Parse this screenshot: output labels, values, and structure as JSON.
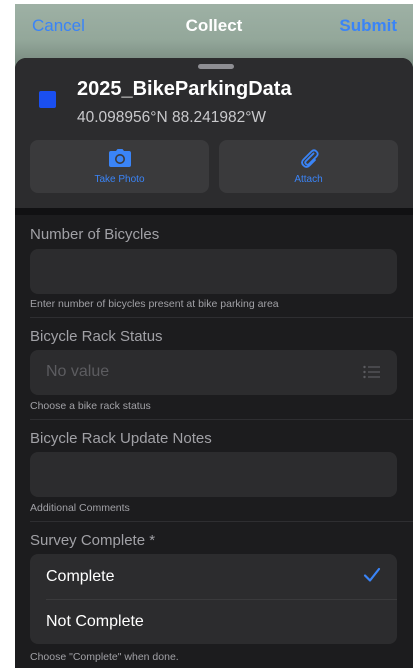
{
  "nav": {
    "cancel_label": "Cancel",
    "title": "Collect",
    "submit_label": "Submit"
  },
  "feature": {
    "layer_name": "2025_BikeParkingData",
    "coordinates": "40.098956°N  88.241982°W",
    "swatch_color": "#1a4ff0"
  },
  "actions": [
    {
      "label": "Take Photo",
      "icon": "camera-icon"
    },
    {
      "label": "Attach",
      "icon": "paperclip-icon"
    }
  ],
  "form": {
    "bicycles": {
      "label": "Number of Bicycles",
      "value": "",
      "hint": "Enter number of bicycles present at bike parking area"
    },
    "rack_status": {
      "label": "Bicycle Rack Status",
      "value": "No value",
      "hint": "Choose a bike rack status",
      "icon": "list-icon"
    },
    "notes": {
      "label": "Bicycle Rack Update Notes",
      "value": "",
      "hint": "Additional Comments"
    },
    "survey_complete": {
      "label": "Survey Complete *",
      "options": [
        "Complete",
        "Not Complete"
      ],
      "selected": "Complete",
      "hint": "Choose \"Complete\" when done."
    }
  },
  "colors": {
    "accent": "#3a84f7",
    "sheet_bg": "#1c1c1e",
    "field_bg": "#2c2c2e"
  }
}
